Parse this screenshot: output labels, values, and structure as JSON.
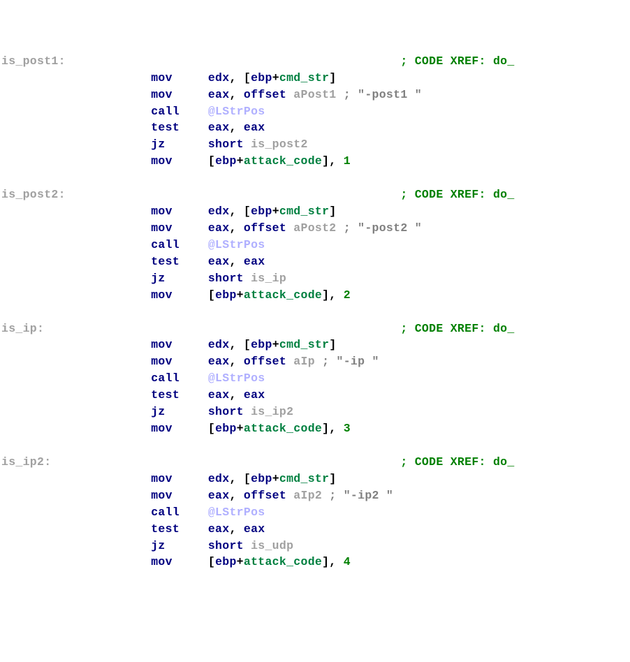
{
  "fn_xref": "do_",
  "var_cmd": "cmd_str",
  "var_atk": "attack_code",
  "fn_lstrpos": "@LStrPos",
  "blocks": [
    {
      "label": "is_post1",
      "branch_target": "is_post2",
      "offset_sym": "aPost1",
      "offset_comment": "\"-post1 \"",
      "code_val": "1"
    },
    {
      "label": "is_post2",
      "branch_target": "is_ip",
      "offset_sym": "aPost2",
      "offset_comment": "\"-post2 \"",
      "code_val": "2"
    },
    {
      "label": "is_ip",
      "branch_target": "is_ip2",
      "offset_sym": "aIp",
      "offset_comment": "\"-ip \"",
      "code_val": "3"
    },
    {
      "label": "is_ip2",
      "branch_target": "is_udp",
      "offset_sym": "aIp2",
      "offset_comment": "\"-ip2 \"",
      "code_val": "4"
    }
  ],
  "pad_label": 21,
  "pad_mnem": 8,
  "tok": {
    "mov": "mov",
    "call": "call",
    "test": "test",
    "jz": "jz",
    "short": "short",
    "edx": "edx",
    "eax": "eax",
    "ebp": "ebp",
    "offset": "offset",
    "xref_prefix": "; CODE XREF: "
  }
}
